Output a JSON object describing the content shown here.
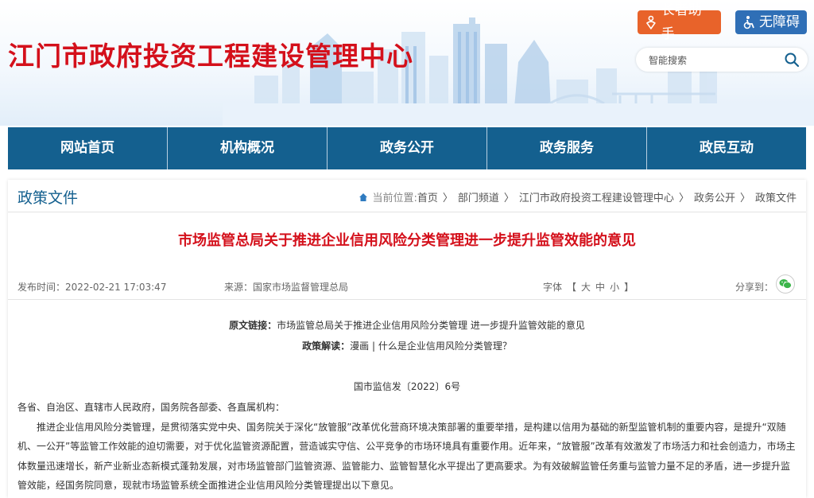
{
  "header": {
    "site_title": "江门市政府投资工程建设管理中心",
    "elder_btn": "长者助手",
    "access_btn": "无障碍",
    "search_placeholder": "智能搜索"
  },
  "nav": {
    "items": [
      "网站首页",
      "机构概况",
      "政务公开",
      "政务服务",
      "政民互动"
    ]
  },
  "section": {
    "title": "政策文件",
    "breadcrumb_label": "当前位置:",
    "breadcrumb": [
      "首页",
      "部门频道",
      "江门市政府投资工程建设管理中心",
      "政务公开",
      "政策文件"
    ]
  },
  "article": {
    "title": "市场监管总局关于推进企业信用风险分类管理进一步提升监管效能的意见",
    "date": "发布时间：2022-02-21 17:03:47",
    "source": "来源：国家市场监督管理总局",
    "font_label": "字体",
    "font_open": "【",
    "font_sizes": [
      "大",
      "中",
      "小"
    ],
    "font_close": "】",
    "share_label": "分享到：",
    "orig_link_label": "原文链接：",
    "orig_link_text": "市场监管总局关于推进企业信用风险分类管理  进一步提升监管效能的意见",
    "interpret_label": "政策解读：",
    "interpret_text": "漫画 | 什么是企业信用风险分类管理？",
    "doc_no": "国市监信发〔2022〕6号",
    "recipients": "各省、自治区、直辖市人民政府，国务院各部委、各直属机构：",
    "paragraph": "推进企业信用风险分类管理，是贯彻落实党中央、国务院关于深化“放管服”改革优化营商环境决策部署的重要举措，是构建以信用为基础的新型监管机制的重要内容，是提升“双随机、一公开”等监管工作效能的迫切需要，对于优化监管资源配置，营造诚实守信、公平竞争的市场环境具有重要作用。近年来，“放管服”改革有效激发了市场活力和社会创造力，市场主体数量迅速增长，新产业新业态新模式蓬勃发展，对市场监管部门监管资源、监管能力、监管智慧化水平提出了更高要求。为有效破解监管任务重与监管力量不足的矛盾，进一步提升监管效能，经国务院同意，现就市场监管系统全面推进企业信用风险分类管理提出以下意见。"
  },
  "colors": {
    "title_red": "#d4101b",
    "nav_blue": "#14608f",
    "elder_orange": "#e8632a",
    "access_blue": "#2f6fb6"
  }
}
